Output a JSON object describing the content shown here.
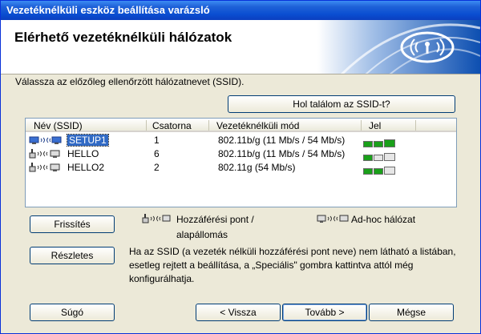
{
  "window": {
    "title": "Vezetéknélküli eszköz beállítása varázsló"
  },
  "header": {
    "title": "Elérhető vezetéknélküli hálózatok",
    "logo_icon": "wifi-logo-icon"
  },
  "instruction": "Válassza az előzőleg ellenőrzött hálózatnevet (SSID).",
  "buttons": {
    "where_ssid": "Hol találom az SSID-t?",
    "refresh": "Frissítés",
    "details": "Részletes",
    "help": "Súgó",
    "back": "< Vissza",
    "next": "Tovább >",
    "cancel": "Mégse"
  },
  "table": {
    "columns": [
      "Név (SSID)",
      "Csatorna",
      "Vezetéknélküli mód",
      "Jel"
    ],
    "rows": [
      {
        "type": "adhoc",
        "ssid": "SETUP1",
        "channel": "1",
        "mode": "802.11b/g (11 Mb/s / 54 Mb/s)",
        "signal_level": 3
      },
      {
        "type": "access-point",
        "ssid": "HELLO",
        "channel": "6",
        "mode": "802.11b/g (11 Mb/s / 54 Mb/s)",
        "signal_level": 1
      },
      {
        "type": "access-point",
        "ssid": "HELLO2",
        "channel": "2",
        "mode": "802.11g (54 Mb/s)",
        "signal_level": 2
      }
    ],
    "selected_row": 0
  },
  "legend": {
    "access_point_line1": "Hozzáférési pont /",
    "access_point_line2": "alapállomás",
    "adhoc": "Ad-hoc hálózat"
  },
  "description": "Ha az SSID (a vezeték nélküli hozzáférési pont neve) nem látható a listában, esetleg rejtett a beállítása, a „Speciális\" gombra kattintva attól még konfigurálhatja.",
  "colors": {
    "title_bar": "#0a4ed1",
    "selection": "#316ac5",
    "signal_on": "#1aa01a",
    "signal_off": "#e6e6e6"
  }
}
